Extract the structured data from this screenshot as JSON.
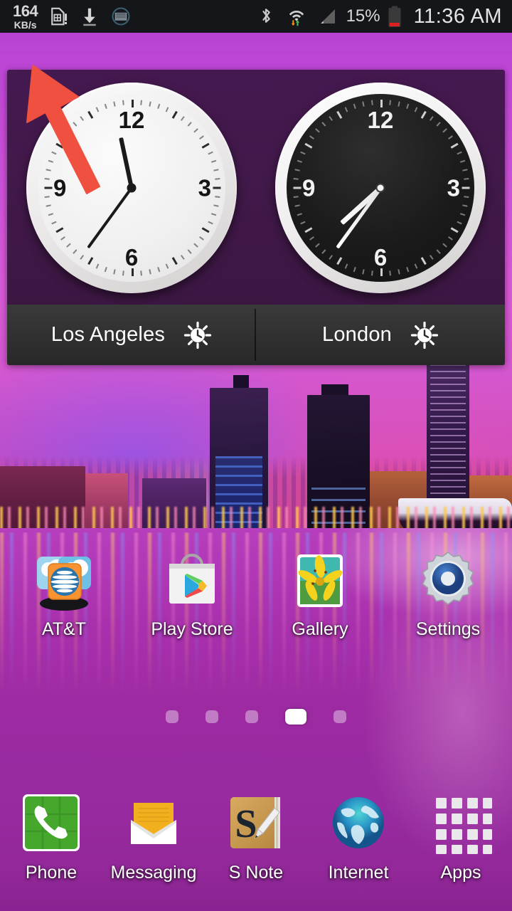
{
  "statusbar": {
    "net_speed_value": "164",
    "net_speed_unit": "KB/s",
    "icons": [
      "sim-card-alert-icon",
      "download-icon",
      "screen-capture-icon",
      "bluetooth-icon",
      "wifi-transfer-icon",
      "signal-bars-icon"
    ],
    "battery_percent": "15%",
    "time": "11:36 AM"
  },
  "clock_widget": {
    "clocks": [
      {
        "city": "Los Angeles",
        "theme": "light",
        "numerals": [
          "12",
          "3",
          "6",
          "9"
        ],
        "hour_angle": 348,
        "minute_angle": 216,
        "dst_icon": "daylight-saving-icon"
      },
      {
        "city": "London",
        "theme": "dark",
        "numerals": [
          "12",
          "3",
          "6",
          "9"
        ],
        "hour_angle": 228,
        "minute_angle": 216,
        "dst_icon": "daylight-saving-icon"
      }
    ]
  },
  "annotation": {
    "arrow_color": "#f0503f",
    "arrow_name": "red-pointer-arrow"
  },
  "apps": [
    {
      "label": "AT&T",
      "icon": "att-folder-icon"
    },
    {
      "label": "Play Store",
      "icon": "play-store-icon"
    },
    {
      "label": "Gallery",
      "icon": "gallery-icon"
    },
    {
      "label": "Settings",
      "icon": "settings-gear-icon"
    }
  ],
  "page_indicator": {
    "total": 5,
    "active_index": 3
  },
  "dock": [
    {
      "label": "Phone",
      "icon": "phone-icon"
    },
    {
      "label": "Messaging",
      "icon": "messaging-envelope-icon"
    },
    {
      "label": "S Note",
      "icon": "s-note-icon"
    },
    {
      "label": "Internet",
      "icon": "internet-globe-icon"
    },
    {
      "label": "Apps",
      "icon": "apps-grid-icon"
    }
  ],
  "colors": {
    "statusbar_bg": "#15161a",
    "battery_low": "#e02020",
    "wallpaper_accent": "#c248d8",
    "widget_bar_bg": "#313131"
  }
}
